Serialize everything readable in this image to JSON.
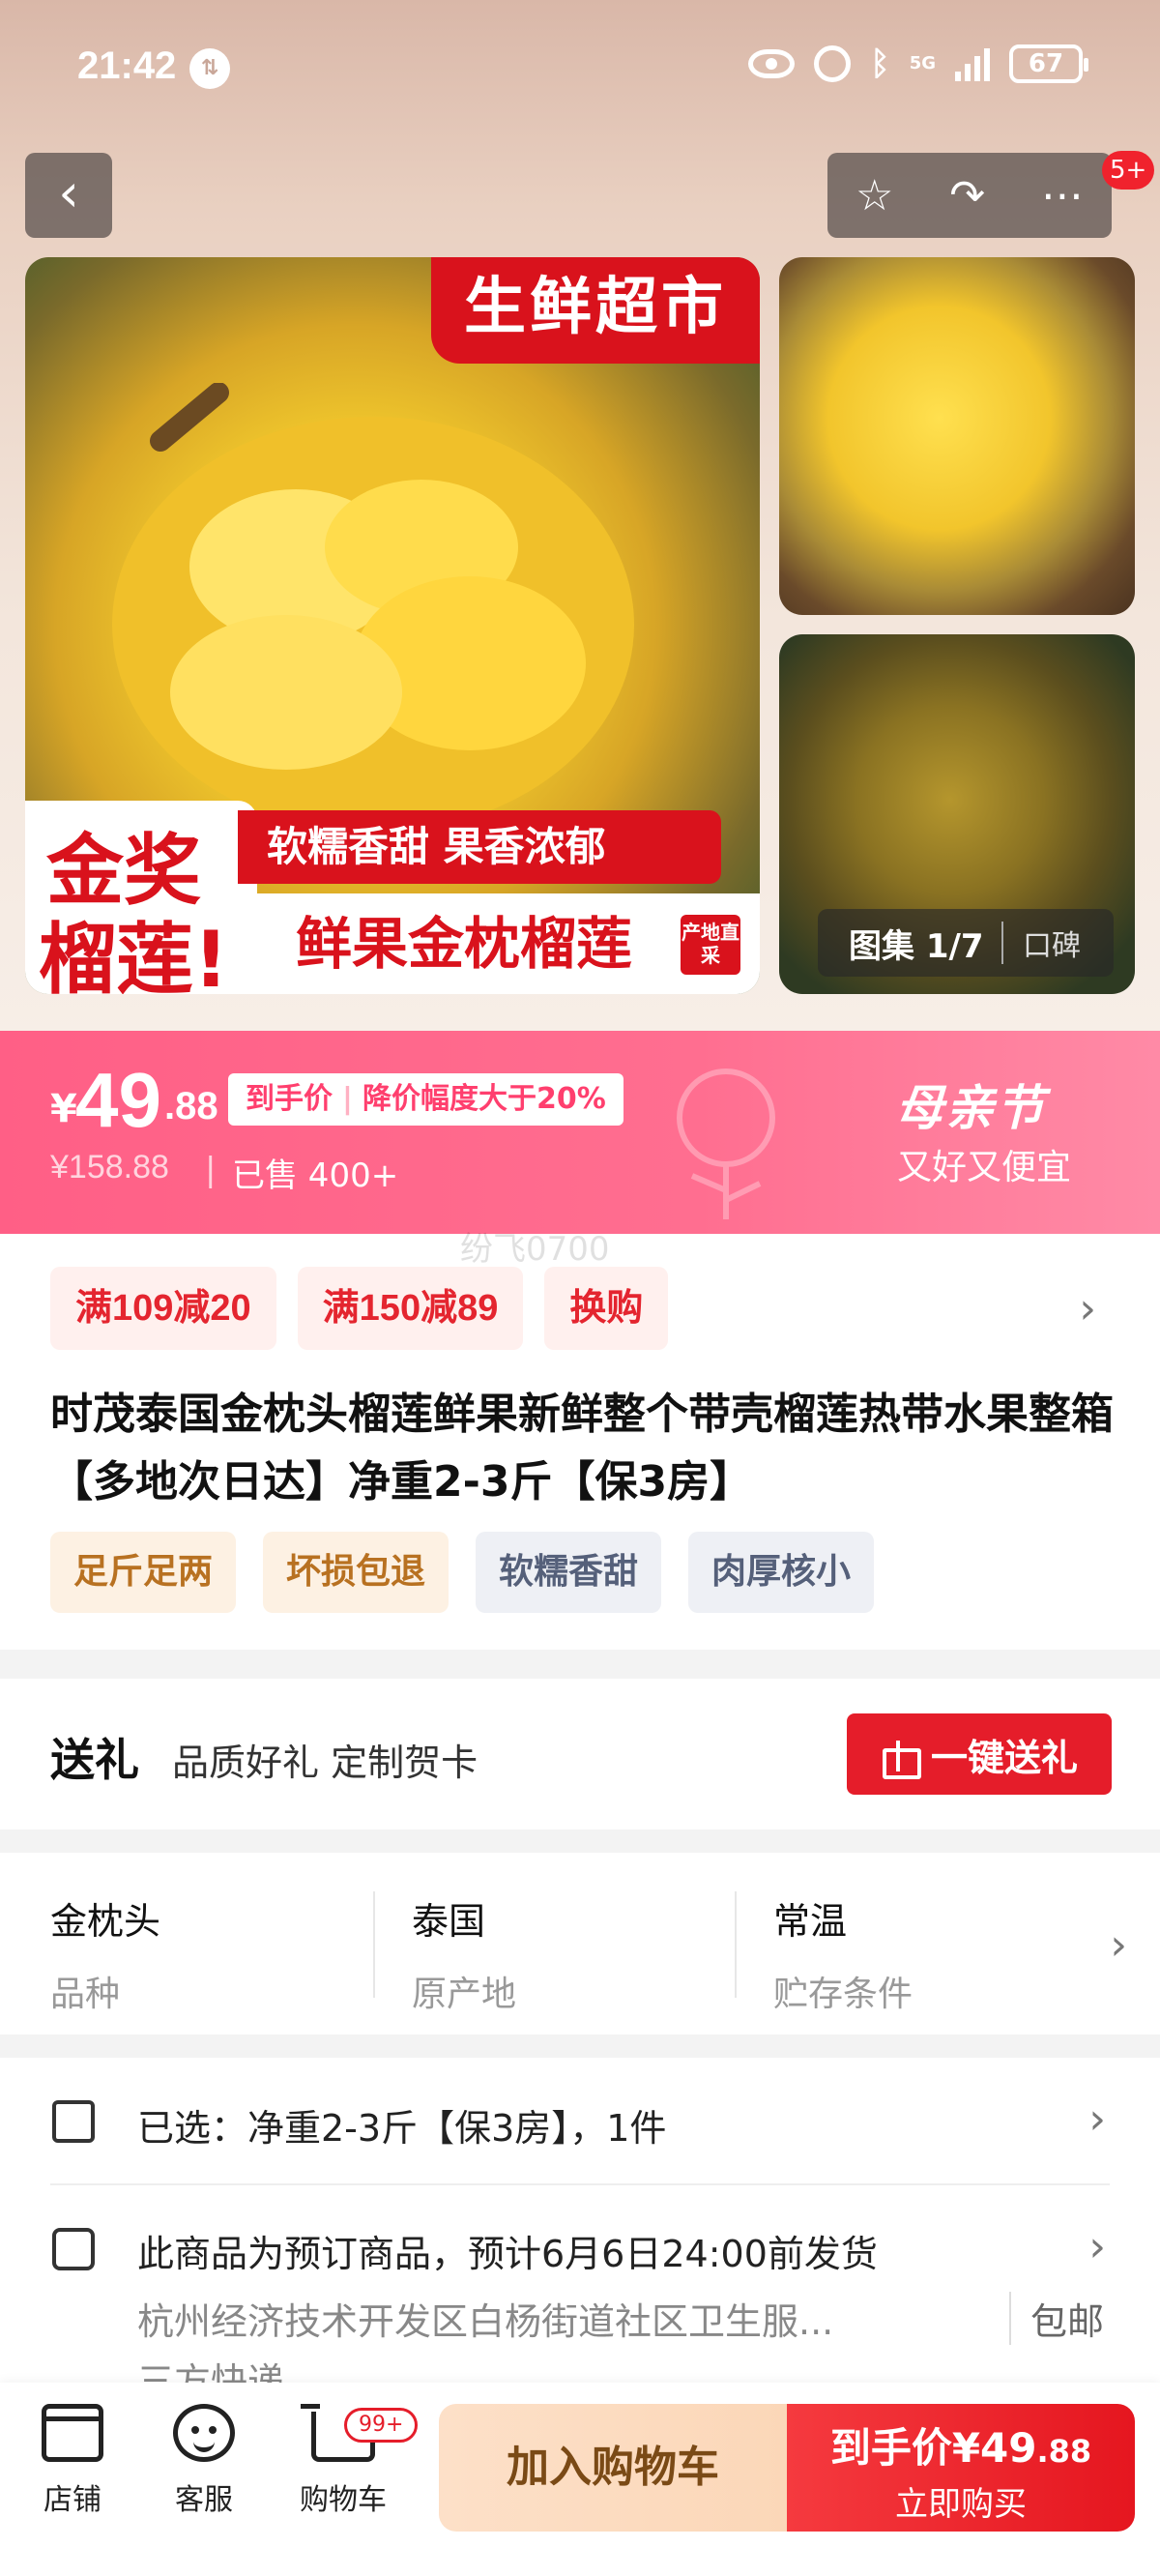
{
  "status_bar": {
    "time": "21:42",
    "battery": "67",
    "network": "5G"
  },
  "nav": {
    "back_icon": "chevron-left-icon",
    "cart_count": "5+"
  },
  "hero": {
    "main_tag": "生鲜超市",
    "badge_line1": "金奖",
    "badge_line2": "榴莲!",
    "strip_text": "软糯香甜  果香浓郁",
    "product_name": "鲜果金枕榴莲",
    "origin_badge": "产地直采",
    "gallery_count": "图集 1/7",
    "gallery_reviews": "口碑"
  },
  "price": {
    "currency": "¥",
    "integer": "49",
    "decimal": ".88",
    "tag_left": "到手价",
    "tag_right": "降价幅度大于20%",
    "original": "¥158.88",
    "divider": "|",
    "sold": "已售 400+",
    "festival_title": "母亲节",
    "festival_sub": "又好又便宜",
    "accent": "#ff5f86"
  },
  "watermark": "纷飞0700",
  "coupons": [
    "满109减20",
    "满150减89",
    "换购"
  ],
  "product_title": "时茂泰国金枕头榴莲鲜果新鲜整个带壳榴莲热带水果整箱【多地次日达】净重2-3斤【保3房】",
  "feature_tags": [
    {
      "text": "足斤足两",
      "tone": "warm"
    },
    {
      "text": "坏损包退",
      "tone": "warm"
    },
    {
      "text": "软糯香甜",
      "tone": "cool"
    },
    {
      "text": "肉厚核小",
      "tone": "cool"
    }
  ],
  "gift": {
    "title": "送礼",
    "subtitle": "品质好礼 定制贺卡",
    "button": "一键送礼"
  },
  "specs": [
    {
      "value": "金枕头",
      "label": "品种"
    },
    {
      "value": "泰国",
      "label": "原产地"
    },
    {
      "value": "常温",
      "label": "贮存条件"
    }
  ],
  "selection": {
    "selected": "已选：净重2-3斤【保3房】，1件",
    "shipping": "此商品为预订商品，预计6月6日24:00前发货",
    "address": "杭州经济技术开发区白杨街道社区卫生服...",
    "free_shipping": "包邮",
    "courier": "三方快递"
  },
  "bottom_bar": {
    "store": "店铺",
    "service": "客服",
    "cart": "购物车",
    "cart_badge": "99+",
    "add_to_cart": "加入购物车",
    "buy_price_label": "到手价¥49",
    "buy_price_decimal": ".88",
    "buy_now": "立即购买"
  }
}
